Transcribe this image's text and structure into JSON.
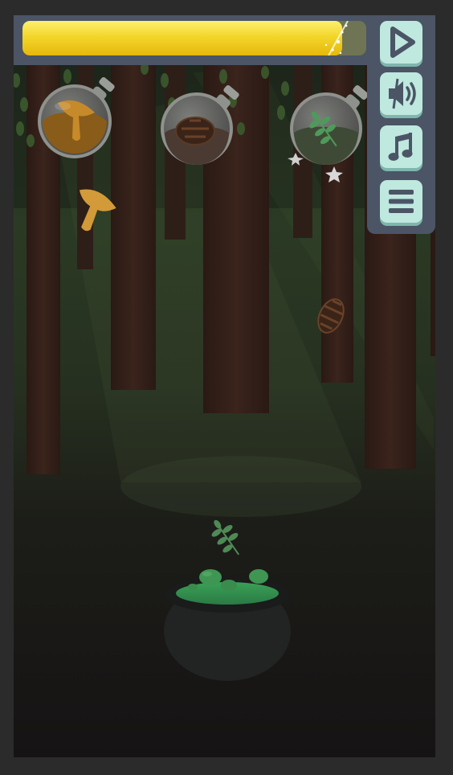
{
  "game": {
    "progress": 0.93,
    "colors": {
      "progress_fill": "#f5d91f",
      "panel": "#4b5566",
      "button": "#bfe8de",
      "button_icon": "#4b5566"
    }
  },
  "controls": [
    {
      "name": "play-button",
      "icon": "play-icon"
    },
    {
      "name": "sound-button",
      "icon": "speaker-muted-icon"
    },
    {
      "name": "music-button",
      "icon": "music-note-icon"
    },
    {
      "name": "menu-button",
      "icon": "hamburger-menu-icon"
    }
  ],
  "flasks": [
    {
      "ingredient": "chanterelle-mushroom",
      "filled": true
    },
    {
      "ingredient": "pine-cone",
      "filled": false
    },
    {
      "ingredient": "herb-leaf",
      "filled": false
    }
  ],
  "falling_ingredients": [
    "chanterelle-mushroom",
    "pine-cone",
    "herb-leaf"
  ],
  "cauldron": {
    "potion_color": "#3e8a4a"
  }
}
